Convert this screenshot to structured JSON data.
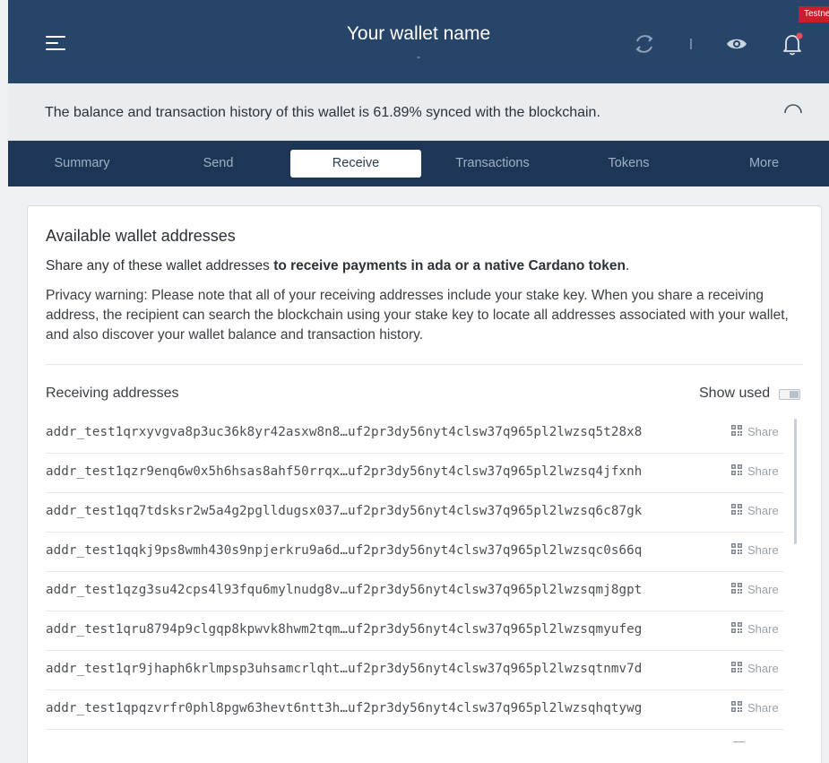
{
  "header": {
    "badge": "Testnet",
    "wallet_name": "Your wallet name",
    "wallet_sub": "-"
  },
  "sync": {
    "message": "The balance and transaction history of this wallet is 61.89% synced with the blockchain."
  },
  "nav": {
    "tabs": [
      {
        "label": "Summary"
      },
      {
        "label": "Send"
      },
      {
        "label": "Receive"
      },
      {
        "label": "Transactions"
      },
      {
        "label": "Tokens"
      },
      {
        "label": "More"
      }
    ],
    "active": "Receive"
  },
  "receive": {
    "title": "Available wallet addresses",
    "desc_prefix": "Share any of these wallet addresses ",
    "desc_bold": "to receive payments in ada or a native Cardano token",
    "desc_suffix": ".",
    "privacy": "Privacy warning: Please note that all of your receiving addresses include your stake key. When you share a receiving address, the recipient can search the blockchain using your stake key to locate all addresses associated with your wallet, and also discover your wallet balance and transaction history.",
    "list_label": "Receiving addresses",
    "show_used_label": "Show used",
    "share_label": "Share",
    "addresses": [
      "addr_test1qrxyvgva8p3uc36k8yr42asxw8n8…uf2pr3dy56nyt4clsw37q965pl2lwzsq5t28x8",
      "addr_test1qzr9enq6w0x5h6hsas8ahf50rrqx…uf2pr3dy56nyt4clsw37q965pl2lwzsq4jfxnh",
      "addr_test1qq7tdsksr2w5a4g2pglldugsx037…uf2pr3dy56nyt4clsw37q965pl2lwzsq6c87gk",
      "addr_test1qqkj9ps8wmh430s9npjerkru9a6d…uf2pr3dy56nyt4clsw37q965pl2lwzsqc0s66q",
      "addr_test1qzg3su42cps4l93fqu6mylnudg8v…uf2pr3dy56nyt4clsw37q965pl2lwzsqmj8gpt",
      "addr_test1qru8794p9clgqp8kpwvk8hwm2tqm…uf2pr3dy56nyt4clsw37q965pl2lwzsqmyufeg",
      "addr_test1qr9jhaph6krlmpsp3uhsamcrlqht…uf2pr3dy56nyt4clsw37q965pl2lwzsqtnmv7d",
      "addr_test1qpqzvrfr0phl8pgw63hevt6ntt3h…uf2pr3dy56nyt4clsw37q965pl2lwzsqhqtywg"
    ]
  },
  "icons": {
    "menu": "hamburger-icon",
    "sync": "sync-icon",
    "eye": "eye-icon",
    "bell": "bell-icon",
    "spinner": "loading-spinner-icon",
    "qr": "qr-code-icon"
  },
  "colors": {
    "header_bg": "#274568",
    "nav_bg": "#1e3655",
    "badge_bg": "#c8202b",
    "notification_dot": "#e84b5a"
  }
}
